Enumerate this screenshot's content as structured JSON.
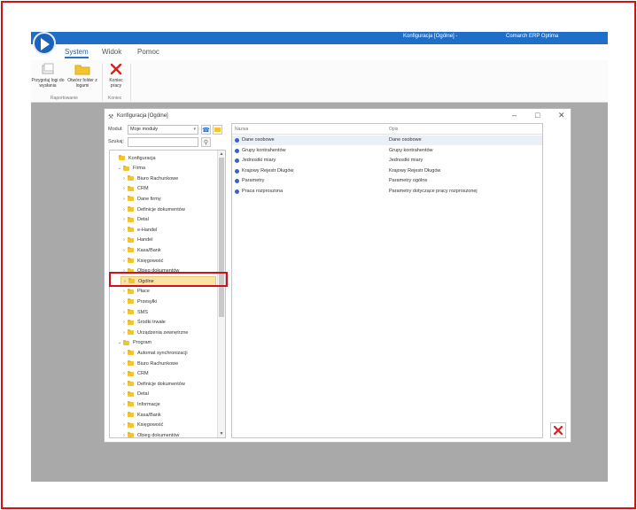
{
  "app": {
    "title_window": "Konfiguracja [Ogólne] -",
    "title_product": "Comarch ERP Optima"
  },
  "menu": {
    "items": [
      "System",
      "Widok",
      "Pomoc"
    ],
    "active": "System"
  },
  "ribbon": {
    "btn_logs": "Przygotuj logi do wysłania",
    "btn_folder": "Otwórz folder z logami",
    "btn_end": "Koniec pracy",
    "group_reports": "Raportowanie",
    "group_end": "Koniec"
  },
  "dialog": {
    "title": "Konfiguracja [Ogólne]",
    "module_label": "Moduł:",
    "module_value": "Moje moduły",
    "search_label": "Szukaj:",
    "search_value": ""
  },
  "tree": [
    {
      "label": "Konfiguracja",
      "level": 0,
      "expanded": true,
      "chevron": false
    },
    {
      "label": "Firma",
      "level": 1,
      "expanded": true,
      "chevron": true
    },
    {
      "label": "Biuro Rachunkowe",
      "level": 2,
      "chevron": true
    },
    {
      "label": "CRM",
      "level": 2,
      "chevron": true
    },
    {
      "label": "Dane firmy",
      "level": 2,
      "chevron": true
    },
    {
      "label": "Definicje dokumentów",
      "level": 2,
      "chevron": true
    },
    {
      "label": "Detal",
      "level": 2,
      "chevron": true
    },
    {
      "label": "e-Handel",
      "level": 2,
      "chevron": true
    },
    {
      "label": "Handel",
      "level": 2,
      "chevron": true
    },
    {
      "label": "Kasa/Bank",
      "level": 2,
      "chevron": true
    },
    {
      "label": "Księgowość",
      "level": 2,
      "chevron": true
    },
    {
      "label": "Obieg dokumentów",
      "level": 2,
      "chevron": true
    },
    {
      "label": "Ogólne",
      "level": 2,
      "chevron": true,
      "selected": true
    },
    {
      "label": "Płace",
      "level": 2,
      "chevron": true
    },
    {
      "label": "Przesyłki",
      "level": 2,
      "chevron": true
    },
    {
      "label": "SMS",
      "level": 2,
      "chevron": true
    },
    {
      "label": "Środki trwałe",
      "level": 2,
      "chevron": true
    },
    {
      "label": "Urządzenia zewnętrzne",
      "level": 2,
      "chevron": true
    },
    {
      "label": "Program",
      "level": 1,
      "expanded": true,
      "chevron": true
    },
    {
      "label": "Automat synchronizacji",
      "level": 2,
      "chevron": true
    },
    {
      "label": "Biuro Rachunkowe",
      "level": 2,
      "chevron": true
    },
    {
      "label": "CRM",
      "level": 2,
      "chevron": true
    },
    {
      "label": "Definicje dokumentów",
      "level": 2,
      "chevron": true
    },
    {
      "label": "Detal",
      "level": 2,
      "chevron": true
    },
    {
      "label": "Informacje",
      "level": 2,
      "chevron": true
    },
    {
      "label": "Kasa/Bank",
      "level": 2,
      "chevron": true
    },
    {
      "label": "Księgowość",
      "level": 2,
      "chevron": true
    },
    {
      "label": "Obieg dokumentów",
      "level": 2,
      "chevron": true
    }
  ],
  "grid": {
    "col_name": "Nazwa",
    "col_desc": "Opis",
    "rows": [
      {
        "name": "Dane osobowe",
        "desc": "Dane osobowe"
      },
      {
        "name": "Grupy kontrahentów",
        "desc": "Grupy kontrahentów"
      },
      {
        "name": "Jednostki miary",
        "desc": "Jednostki miary"
      },
      {
        "name": "Krajowy Rejestr Długów",
        "desc": "Krajowy Rejestr Długów"
      },
      {
        "name": "Parametry",
        "desc": "Parametry ogólne"
      },
      {
        "name": "Praca rozproszona",
        "desc": "Parametry dotyczące pracy rozproszonej"
      }
    ]
  },
  "colors": {
    "titlebar": "#1f6fc9",
    "highlight": "#d0111b",
    "selected": "#fbe3a4"
  }
}
